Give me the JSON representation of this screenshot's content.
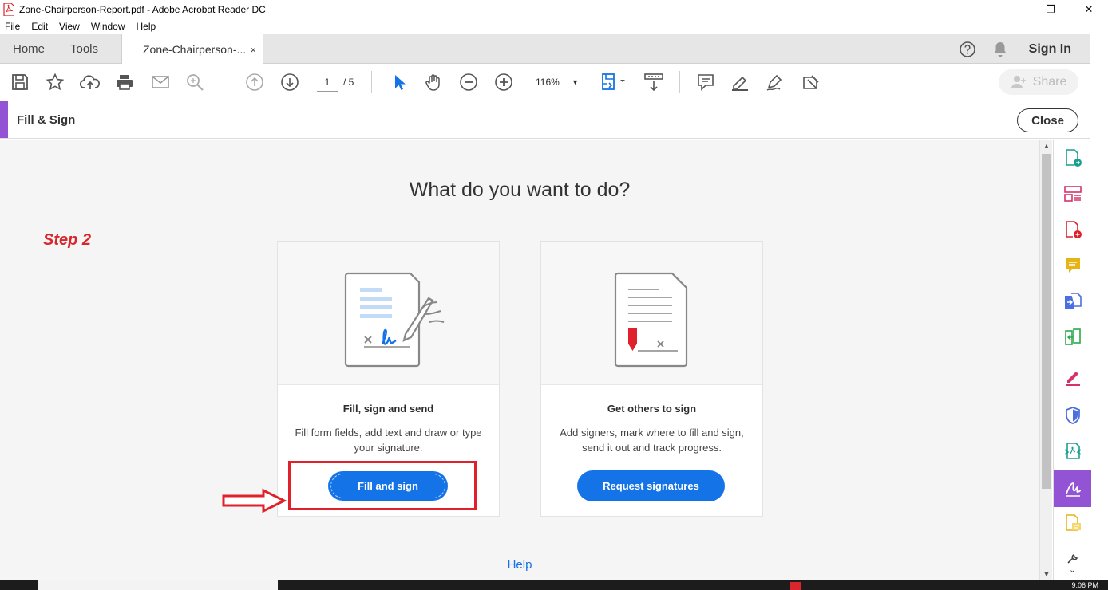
{
  "window": {
    "title": "Zone-Chairperson-Report.pdf - Adobe Acrobat Reader DC",
    "minimize": "—",
    "restore": "❐",
    "close": "✕"
  },
  "menu": [
    "File",
    "Edit",
    "View",
    "Window",
    "Help"
  ],
  "tabs": {
    "home": "Home",
    "tools": "Tools",
    "document": "Zone-Chairperson-...",
    "close_glyph": "×"
  },
  "header_right": {
    "sign_in": "Sign In"
  },
  "toolbar": {
    "current_page": "1",
    "page_total": "/ 5",
    "zoom": "116%",
    "zoom_arrow": "▼",
    "share": "Share"
  },
  "fill_sign": {
    "panel_label": "Fill & Sign",
    "close": "Close",
    "heading": "What do you want to do?",
    "annotation": "Step 2",
    "help": "Help"
  },
  "cards": [
    {
      "title": "Fill, sign and send",
      "description": "Fill form fields, add text and draw or type your signature.",
      "button": "Fill and sign"
    },
    {
      "title": "Get others to sign",
      "description": "Add signers, mark where to fill and sign, send it out and track progress.",
      "button": "Request signatures"
    }
  ],
  "scrollbar": {
    "up": "▲",
    "down": "▼"
  },
  "right_panel": {
    "collapse": "⌄"
  },
  "taskbar": {
    "clock": "9:06 PM"
  },
  "colors": {
    "accent_purple": "#9253d4",
    "primary_blue": "#1473e6",
    "annotation_red": "#e0202a"
  }
}
